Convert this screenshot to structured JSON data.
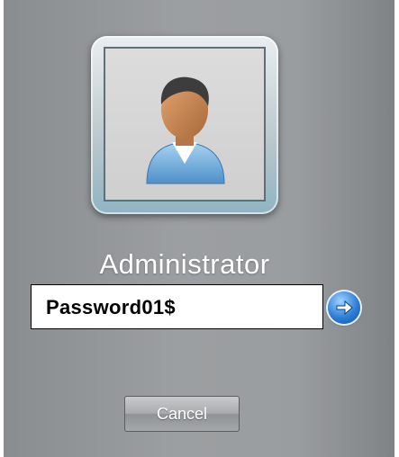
{
  "user_tile": {
    "icon": "user-avatar-icon"
  },
  "username": "Administrator",
  "password": {
    "value": "Password01$"
  },
  "submit": {
    "icon": "arrow-right-icon"
  },
  "cancel": {
    "label": "Cancel"
  },
  "colors": {
    "background": "#9c9fa1",
    "submit_accent": "#2f7fd8",
    "text": "#ffffff"
  }
}
